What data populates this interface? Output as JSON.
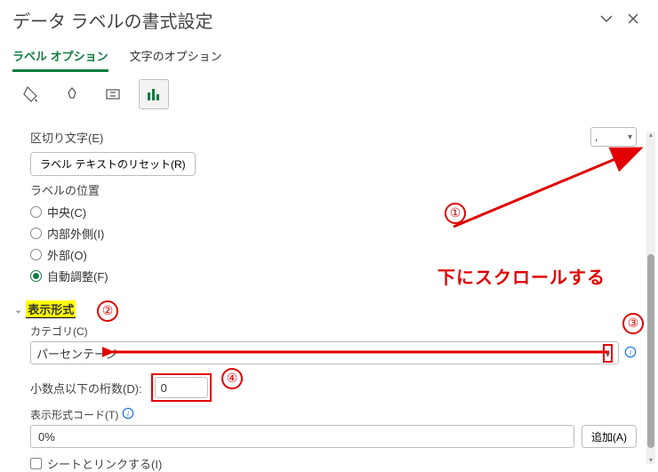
{
  "panel": {
    "title": "データ ラベルの書式設定",
    "tabs": {
      "label_options": "ラベル オプション",
      "text_options": "文字のオプション"
    }
  },
  "separator": {
    "label": "区切り文字(E)",
    "value": ","
  },
  "reset_label": "ラベル テキストのリセット(R)",
  "position": {
    "heading": "ラベルの位置",
    "center": "中央(C)",
    "inside_end": "内部外側(I)",
    "outside": "外部(O)",
    "best_fit": "自動調整(F)"
  },
  "number_section": {
    "title": "表示形式",
    "category_label": "カテゴリ(C)",
    "category_value": "パーセンテージ",
    "decimals_label": "小数点以下の桁数(D):",
    "decimals_value": "0",
    "code_label": "表示形式コード(T)",
    "code_value": "0%",
    "add_label": "追加(A)",
    "link_label": "シートとリンクする(I)"
  },
  "annotations": {
    "c1": "①",
    "c2": "②",
    "c3": "③",
    "c4": "④",
    "scroll_text": "下にスクロールする"
  }
}
